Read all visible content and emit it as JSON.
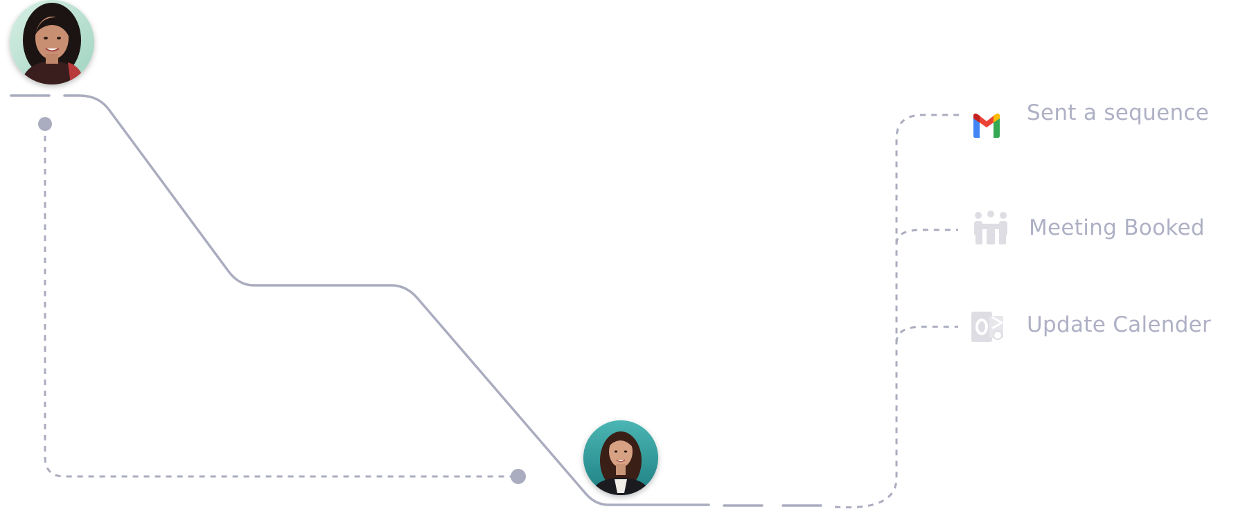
{
  "flow": {
    "steps": [
      {
        "label": "Sent a sequence",
        "icon": "gmail-icon"
      },
      {
        "label": "Meeting Booked",
        "icon": "meeting-icon"
      },
      {
        "label": "Update Calender",
        "icon": "outlook-icon"
      }
    ]
  },
  "colors": {
    "line": "#aaacbf",
    "label": "#aeb0c5",
    "icon_gray": "#dddde3",
    "gmail_red": "#ea4335",
    "gmail_blue": "#4285f4",
    "gmail_green": "#34a853",
    "gmail_yellow": "#fbbc04"
  },
  "avatars": [
    {
      "name": "avatar-woman-top-left"
    },
    {
      "name": "avatar-woman-bottom-center"
    }
  ]
}
